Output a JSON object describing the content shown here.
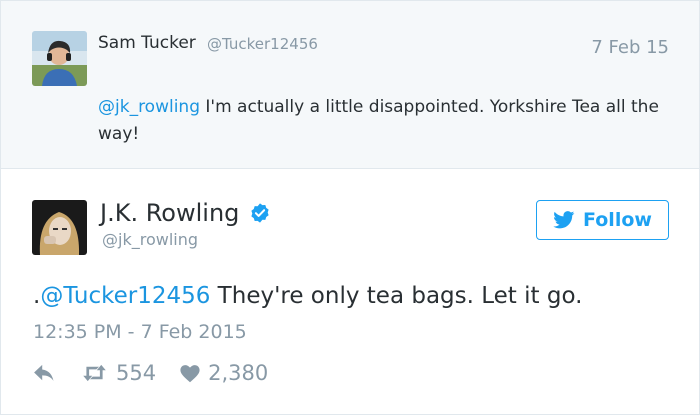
{
  "parent_tweet": {
    "name": "Sam Tucker",
    "handle": "@Tucker12456",
    "date": "7 Feb 15",
    "mention": "@jk_rowling",
    "text": " I'm actually a little disappointed. Yorkshire Tea all the way!"
  },
  "main_tweet": {
    "name": "J.K. Rowling",
    "handle": "@jk_rowling",
    "verified": true,
    "follow_label": "Follow",
    "text_prefix": ".",
    "mention": "@Tucker12456",
    "text": " They're only tea bags. Let it go.",
    "timestamp": "12:35 PM - 7 Feb 2015",
    "retweets": "554",
    "likes": "2,380"
  },
  "colors": {
    "accent": "#1da1f2",
    "mention": "#1b95e0",
    "muted": "#8899a6",
    "text": "#292f33",
    "parent_bg": "#f5f8fa"
  },
  "icons": [
    "reply-icon",
    "retweet-icon",
    "like-icon",
    "verified-badge-icon",
    "twitter-bird-icon"
  ]
}
